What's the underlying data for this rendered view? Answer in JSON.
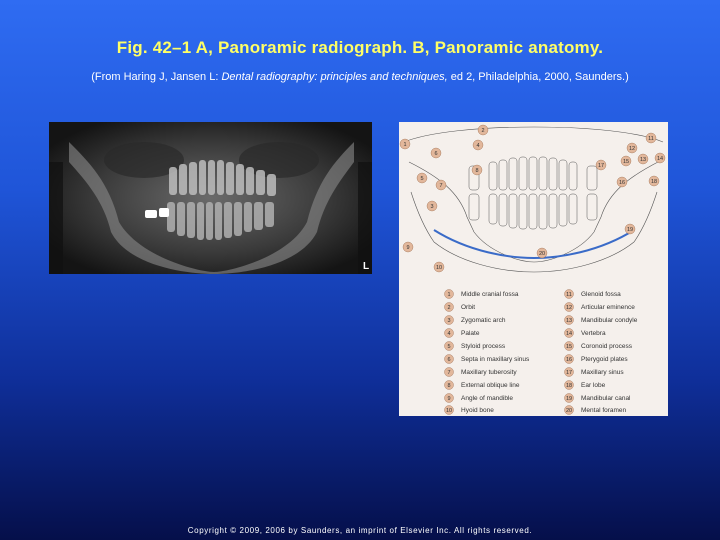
{
  "slide": {
    "title": "Fig. 42–1 A, Panoramic radiograph. B, Panoramic anatomy.",
    "citation_prefix": "(From Haring J, Jansen L: ",
    "citation_italic": "Dental radiography: principles and techniques,",
    "citation_suffix": " ed 2, Philadelphia, 2000, Saunders.)",
    "xray_marker": "L",
    "copyright": "Copyright © 2009, 2006 by Saunders, an imprint of Elsevier Inc. All rights reserved."
  },
  "legend": [
    {
      "n": "1",
      "label": "Middle cranial fossa"
    },
    {
      "n": "2",
      "label": "Orbit"
    },
    {
      "n": "3",
      "label": "Zygomatic arch"
    },
    {
      "n": "4",
      "label": "Palate"
    },
    {
      "n": "5",
      "label": "Styloid process"
    },
    {
      "n": "6",
      "label": "Septa in maxillary sinus"
    },
    {
      "n": "7",
      "label": "Maxillary tuberosity"
    },
    {
      "n": "8",
      "label": "External oblique line"
    },
    {
      "n": "9",
      "label": "Angle of mandible"
    },
    {
      "n": "10",
      "label": "Hyoid bone"
    },
    {
      "n": "11",
      "label": "Glenoid fossa"
    },
    {
      "n": "12",
      "label": "Articular eminence"
    },
    {
      "n": "13",
      "label": "Mandibular condyle"
    },
    {
      "n": "14",
      "label": "Vertebra"
    },
    {
      "n": "15",
      "label": "Coronoid process"
    },
    {
      "n": "16",
      "label": "Pterygoid plates"
    },
    {
      "n": "17",
      "label": "Maxillary sinus"
    },
    {
      "n": "18",
      "label": "Ear lobe"
    },
    {
      "n": "19",
      "label": "Mandibular canal"
    },
    {
      "n": "20",
      "label": "Mental foramen"
    }
  ],
  "diagram_labels": [
    "1",
    "2",
    "3",
    "4",
    "5",
    "6",
    "7",
    "8",
    "9",
    "10",
    "11",
    "12",
    "13",
    "14",
    "15",
    "16",
    "17",
    "18",
    "19",
    "20"
  ]
}
